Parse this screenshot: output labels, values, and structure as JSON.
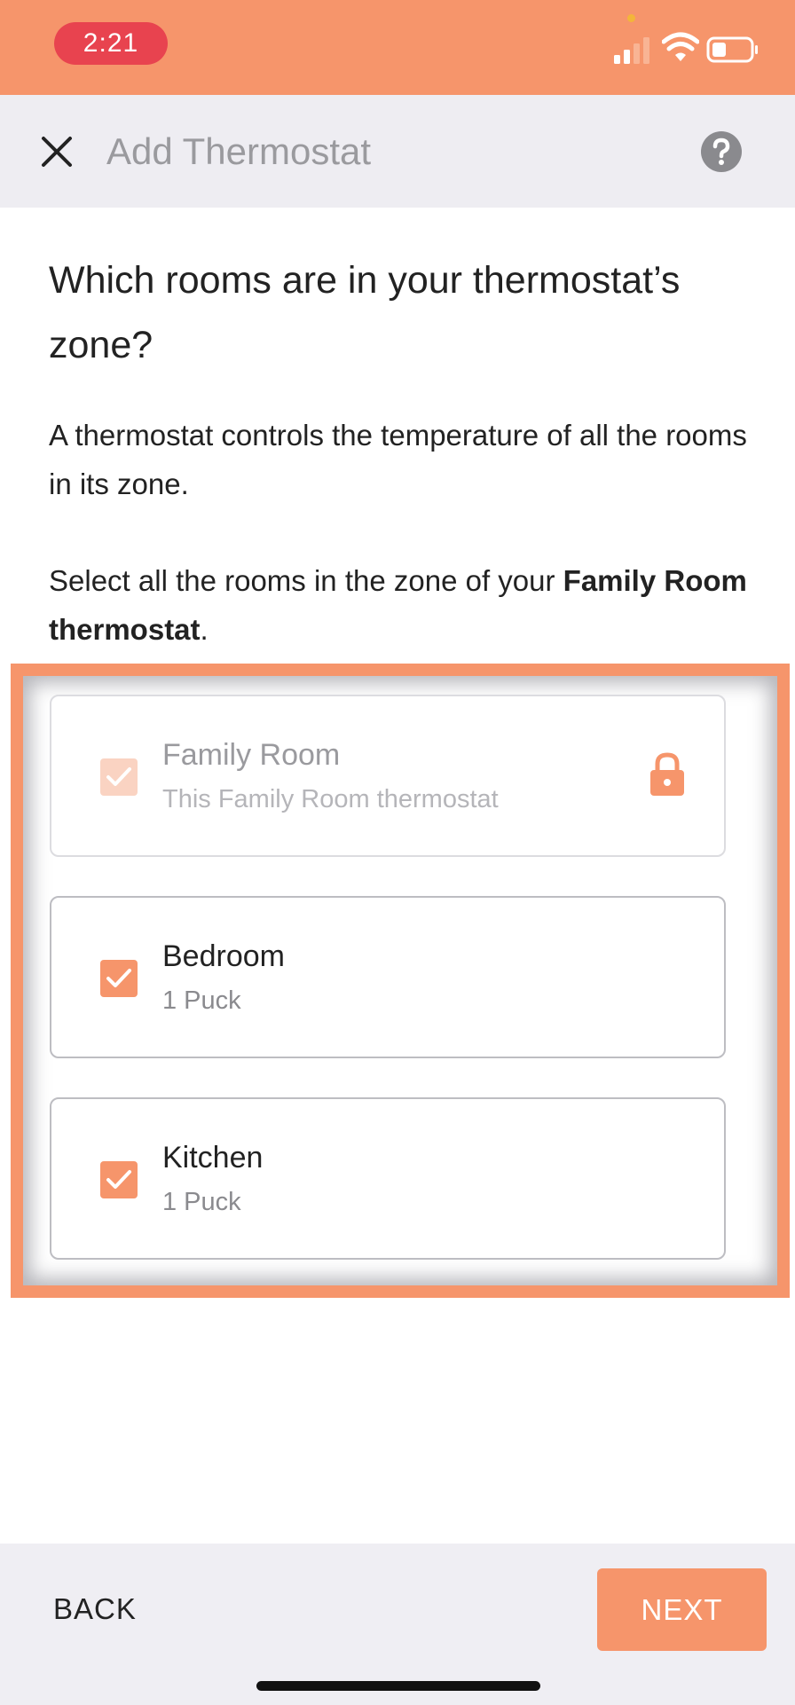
{
  "status_bar": {
    "time": "2:21",
    "accent_color": "#F6956B",
    "time_pill_color": "#E8434F",
    "icons": [
      "signal-icon",
      "wifi-icon",
      "battery-icon"
    ]
  },
  "nav": {
    "title": "Add Thermostat",
    "close_icon": "close-icon",
    "help_icon": "help-icon"
  },
  "content": {
    "heading": "Which rooms are in your thermostat’s zone?",
    "description": "A thermostat controls the temperature of all the rooms in its zone.",
    "instruction_prefix": "Select all the rooms in the zone of your ",
    "instruction_bold": "Family Room thermostat",
    "instruction_suffix": "."
  },
  "rooms": [
    {
      "name": "Family Room",
      "subtitle": "This Family Room thermostat",
      "checked": true,
      "locked": true,
      "icon": "lock-icon"
    },
    {
      "name": "Bedroom",
      "subtitle": "1 Puck",
      "checked": true,
      "locked": false
    },
    {
      "name": "Kitchen",
      "subtitle": "1 Puck",
      "checked": true,
      "locked": false
    }
  ],
  "footer": {
    "back_label": "BACK",
    "next_label": "NEXT",
    "accent_color": "#F6956B"
  }
}
